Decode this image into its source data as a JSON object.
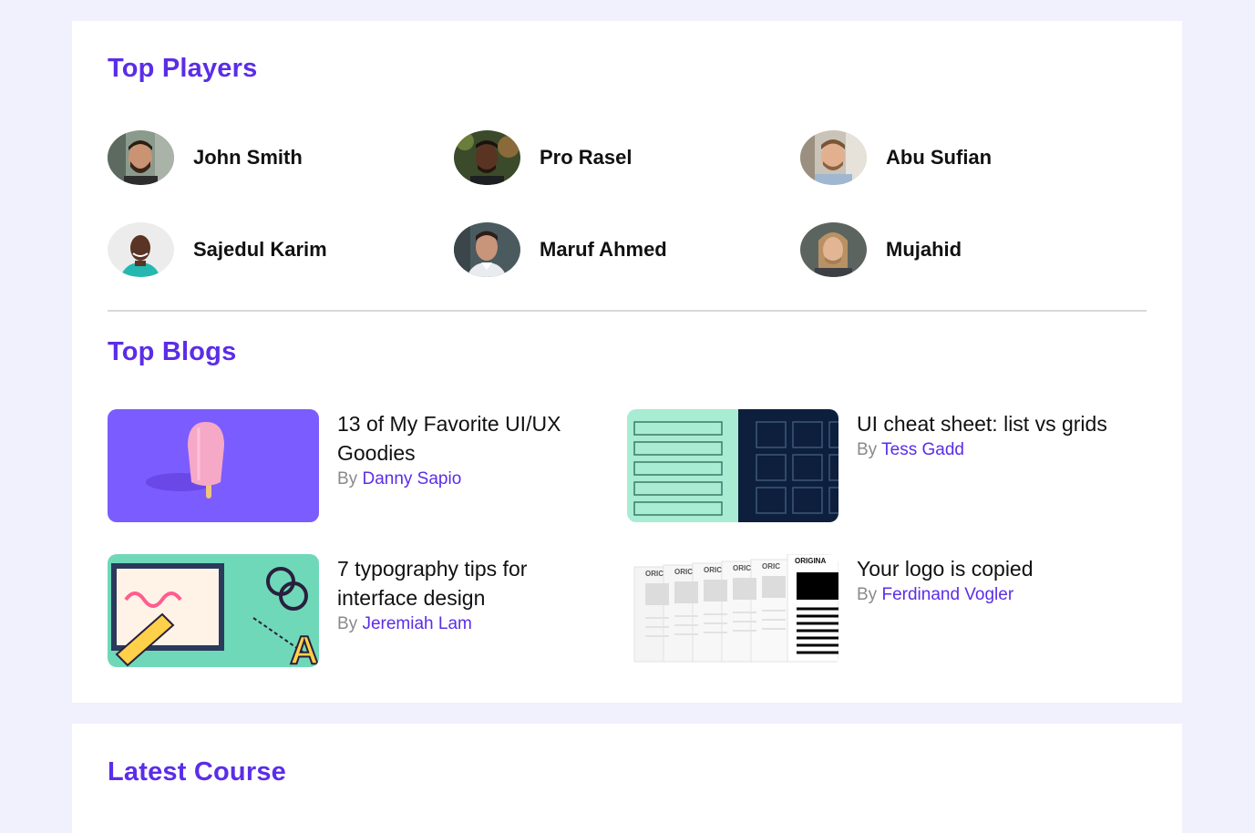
{
  "top_players": {
    "title": "Top Players",
    "players": [
      {
        "name": "John Smith"
      },
      {
        "name": "Pro Rasel"
      },
      {
        "name": "Abu Sufian"
      },
      {
        "name": "Sajedul Karim"
      },
      {
        "name": "Maruf Ahmed"
      },
      {
        "name": "Mujahid"
      }
    ]
  },
  "top_blogs": {
    "title": "Top Blogs",
    "by_label": "By",
    "blogs": [
      {
        "title": "13 of My Favorite UI/UX Goodies",
        "author": "Danny Sapio"
      },
      {
        "title": "UI cheat sheet: list vs grids",
        "author": "Tess Gadd"
      },
      {
        "title": "7 typography tips for interface design",
        "author": "Jeremiah Lam"
      },
      {
        "title": "Your logo is copied",
        "author": "Ferdinand Vogler"
      }
    ],
    "thumb_text": {
      "original": "ORIGINA",
      "original_short": "ORIC"
    }
  },
  "latest_course": {
    "title": "Latest Course"
  },
  "colors": {
    "accent": "#5b2de8",
    "page_bg": "#f1f0fd",
    "card_bg": "#ffffff"
  }
}
